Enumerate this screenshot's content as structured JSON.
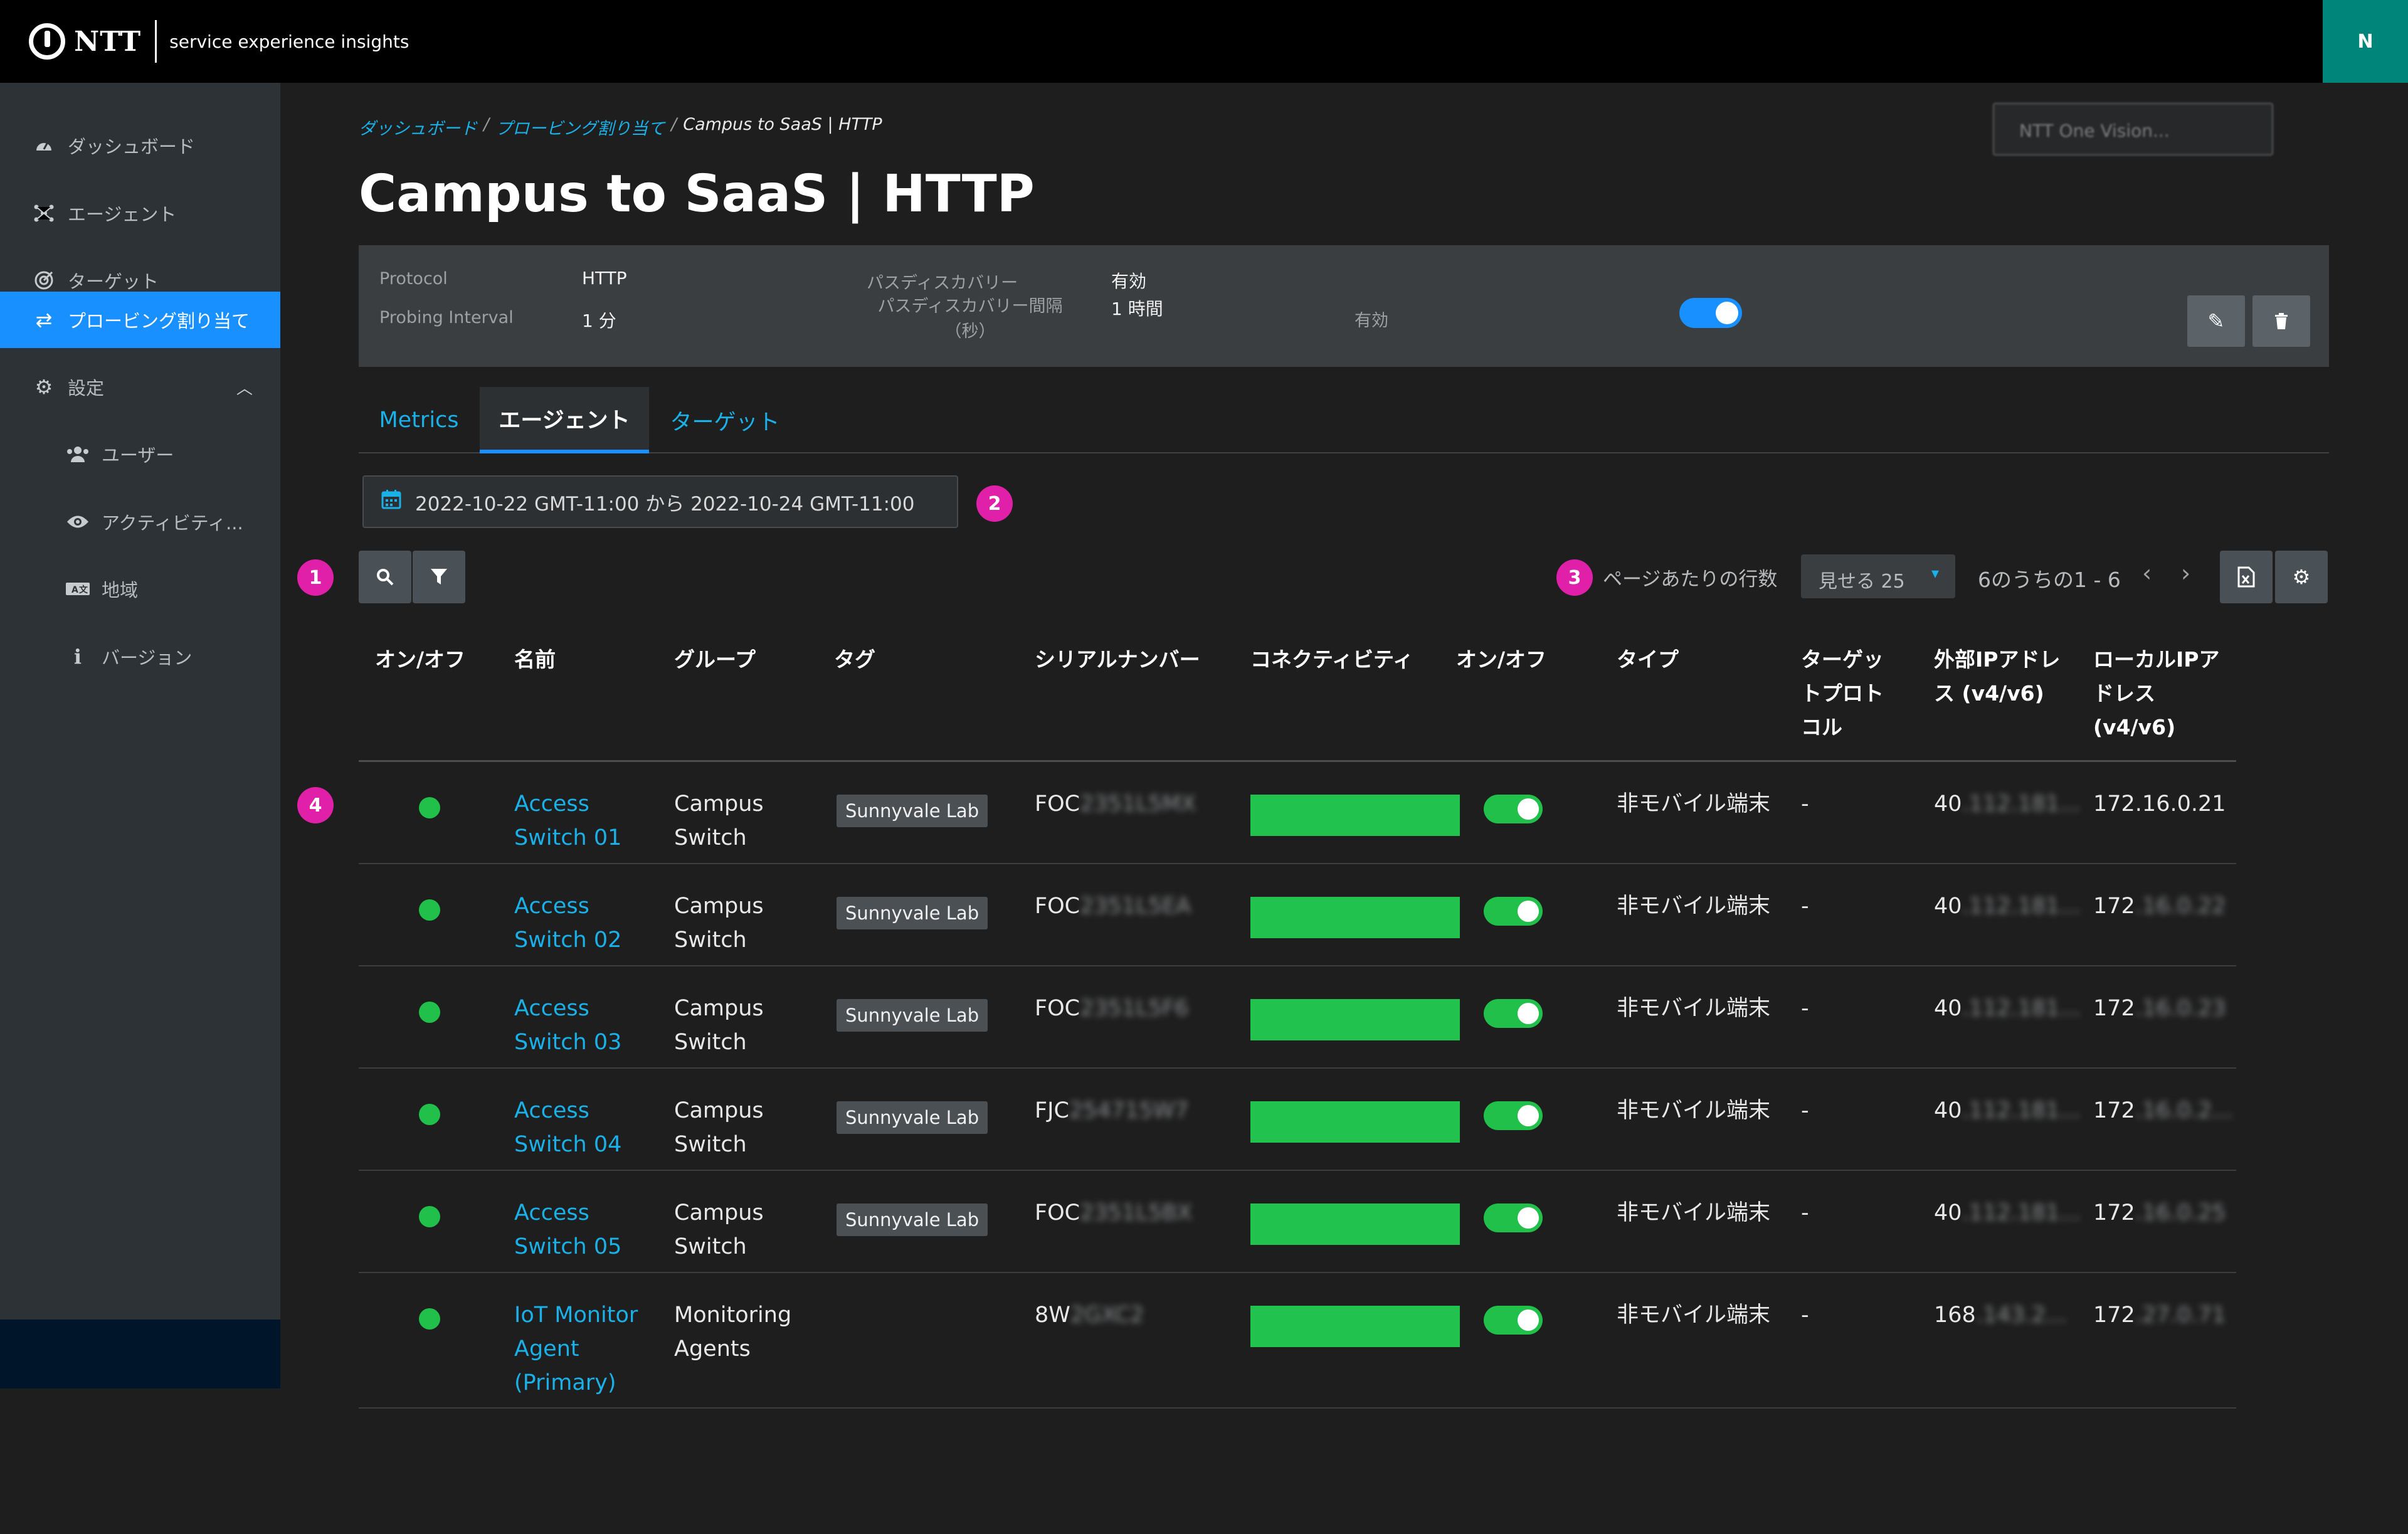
{
  "header": {
    "brand": "NTT",
    "product": "service experience insights",
    "user_initial": "N"
  },
  "sidebar": {
    "items": [
      {
        "label": "ダッシュボード",
        "icon": "dashboard-icon"
      },
      {
        "label": "エージェント",
        "icon": "agents-icon"
      },
      {
        "label": "ターゲット",
        "icon": "target-icon"
      },
      {
        "label": "プロービング割り当て",
        "icon": "swap-icon"
      },
      {
        "label": "設定",
        "icon": "gear-icon"
      },
      {
        "label": "ユーザー",
        "icon": "users-icon"
      },
      {
        "label": "アクティビティ...",
        "icon": "eye-icon"
      },
      {
        "label": "地域",
        "icon": "region-icon"
      },
      {
        "label": "バージョン",
        "icon": "info-icon"
      }
    ]
  },
  "breadcrumb": {
    "home": "ダッシュボード",
    "section": "プロービング割り当て",
    "current": "Campus to SaaS | HTTP"
  },
  "vision_select": "NTT One Vision...",
  "title": "Campus to SaaS | HTTP",
  "info": {
    "protocol_label": "Protocol",
    "protocol_value": "HTTP",
    "interval_label": "Probing Interval",
    "interval_value": "1 分",
    "path_label": "パスディスカバリー",
    "path_value": "有効",
    "path_interval_label": "パスディスカバリー間隔（秒）",
    "path_interval_value": "1 時間",
    "enabled_label": "有効"
  },
  "tabs": [
    "Metrics",
    "エージェント",
    "ターゲット"
  ],
  "date_range": "2022-10-22 GMT-11:00 から 2022-10-24 GMT-11:00",
  "badges": [
    "1",
    "2",
    "3",
    "4"
  ],
  "pagination": {
    "rows_label": "ページあたりの行数",
    "rows_value": "見せる 25",
    "range": "6のうちの1 - 6"
  },
  "table": {
    "headers": [
      "オン/オフ",
      "名前",
      "グループ",
      "タグ",
      "シリアルナンバー",
      "コネクティビティ",
      "オン/オフ",
      "タイプ",
      "ターゲットプロトコル",
      "外部IPアドレス (v4/v6)",
      "ローカルIPアドレス (v4/v6)"
    ],
    "rows": [
      {
        "name": "Access Switch 01",
        "group": "Campus Switch",
        "tag": "Sunnyvale Lab",
        "serial": "FOC",
        "serial_hidden": "2351L5MX",
        "type": "非モバイル端末",
        "protocol": "-",
        "ext_ip": "40",
        "ext_hidden": ".112.181...",
        "local_ip": "172.16.0.21",
        "local_hidden": ""
      },
      {
        "name": "Access Switch 02",
        "group": "Campus Switch",
        "tag": "Sunnyvale Lab",
        "serial": "FOC",
        "serial_hidden": "2351L5EA",
        "type": "非モバイル端末",
        "protocol": "-",
        "ext_ip": "40",
        "ext_hidden": ".112.181...",
        "local_ip": "172",
        "local_hidden": ".16.0.22"
      },
      {
        "name": "Access Switch 03",
        "group": "Campus Switch",
        "tag": "Sunnyvale Lab",
        "serial": "FOC",
        "serial_hidden": "2351L5F6",
        "type": "非モバイル端末",
        "protocol": "-",
        "ext_ip": "40",
        "ext_hidden": ".112.181...",
        "local_ip": "172",
        "local_hidden": ".16.0.23"
      },
      {
        "name": "Access Switch 04",
        "group": "Campus Switch",
        "tag": "Sunnyvale Lab",
        "serial": "FJC",
        "serial_hidden": "254715W7",
        "type": "非モバイル端末",
        "protocol": "-",
        "ext_ip": "40",
        "ext_hidden": ".112.181...",
        "local_ip": "172",
        "local_hidden": ".16.0.2..."
      },
      {
        "name": "Access Switch 05",
        "group": "Campus Switch",
        "tag": "Sunnyvale Lab",
        "serial": "FOC",
        "serial_hidden": "2351L5BX",
        "type": "非モバイル端末",
        "protocol": "-",
        "ext_ip": "40",
        "ext_hidden": ".112.181...",
        "local_ip": "172",
        "local_hidden": ".16.0.25"
      },
      {
        "name": "IoT Monitor Agent (Primary)",
        "group": "Monitoring Agents",
        "tag": "",
        "serial": "8W",
        "serial_hidden": "2GXC2",
        "type": "非モバイル端末",
        "protocol": "-",
        "ext_ip": "168",
        "ext_hidden": ".143.2...",
        "local_ip": "172",
        "local_hidden": ".27.0.71"
      }
    ]
  },
  "colors": {
    "accent": "#1890ff",
    "link": "#1ab0e8",
    "status_ok": "#20c04a",
    "badge": "#e020a8",
    "avatar": "#00857a"
  }
}
